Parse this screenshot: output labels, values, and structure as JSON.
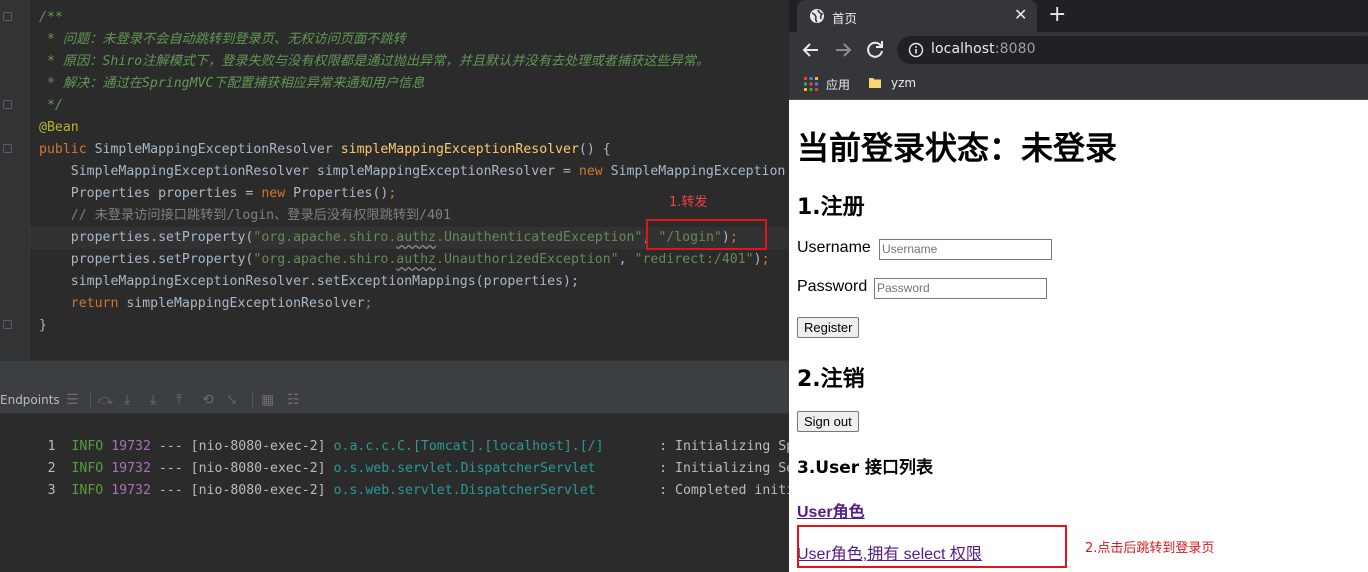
{
  "ide": {
    "code_lines": [
      "/**",
      " * 问题：未登录不会自动跳转到登录页、无权访问页面不跳转",
      " * 原因：Shiro注解模式下，登录失败与没有权限都是通过抛出异常，并且默认并没有去处理或者捕获这些异常。",
      " * 解决：通过在SpringMVC下配置捕获相应异常来通知用户信息",
      " */",
      "@Bean",
      "public SimpleMappingExceptionResolver simpleMappingExceptionResolver() {",
      "    SimpleMappingExceptionResolver simpleMappingExceptionResolver = new SimpleMappingException",
      "    Properties properties = new Properties();",
      "    // 未登录访问接口跳转到/login、登录后没有权限跳转到/401",
      "    properties.setProperty(\"org.apache.shiro.authz.UnauthenticatedException\", \"/login\");",
      "    properties.setProperty(\"org.apache.shiro.authz.UnauthorizedException\", \"redirect:/401\");",
      "    simpleMappingExceptionResolver.setExceptionMappings(properties);",
      "    return simpleMappingExceptionResolver;",
      "}"
    ],
    "annotation_1": "1.转发",
    "panel_label": "Endpoints",
    "logs": [
      {
        "num": "1",
        "level": "INFO",
        "pid": "19732",
        "sep": "---",
        "thread": "[nio-8080-exec-2]",
        "logger": "o.a.c.c.C.[Tomcat].[localhost].[/]      ",
        "msg": ": Initializing Spring"
      },
      {
        "num": "2",
        "level": "INFO",
        "pid": "19732",
        "sep": "---",
        "thread": "[nio-8080-exec-2]",
        "logger": "o.s.web.servlet.DispatcherServlet       ",
        "msg": ": Initializing Servlet"
      },
      {
        "num": "3",
        "level": "INFO",
        "pid": "19732",
        "sep": "---",
        "thread": "[nio-8080-exec-2]",
        "logger": "o.s.web.servlet.DispatcherServlet       ",
        "msg": ": Completed initializa"
      }
    ]
  },
  "browser": {
    "tab_title": "首页",
    "url_host": "localhost",
    "url_port": ":8080",
    "bookmarks": [
      "应用",
      "yzm"
    ]
  },
  "page": {
    "title": "当前登录状态：未登录",
    "register_heading": "1.注册",
    "username_label": "Username",
    "username_placeholder": "Username",
    "password_label": "Password",
    "password_placeholder": "Password",
    "register_button": "Register",
    "logout_heading": "2.注销",
    "signout_button": "Sign out",
    "api_heading": "3.User 接口列表",
    "link_user_role": "User角色",
    "link_user_select": "User角色,拥有 select 权限",
    "annotation_2": "2.点击后跳转到登录页"
  }
}
